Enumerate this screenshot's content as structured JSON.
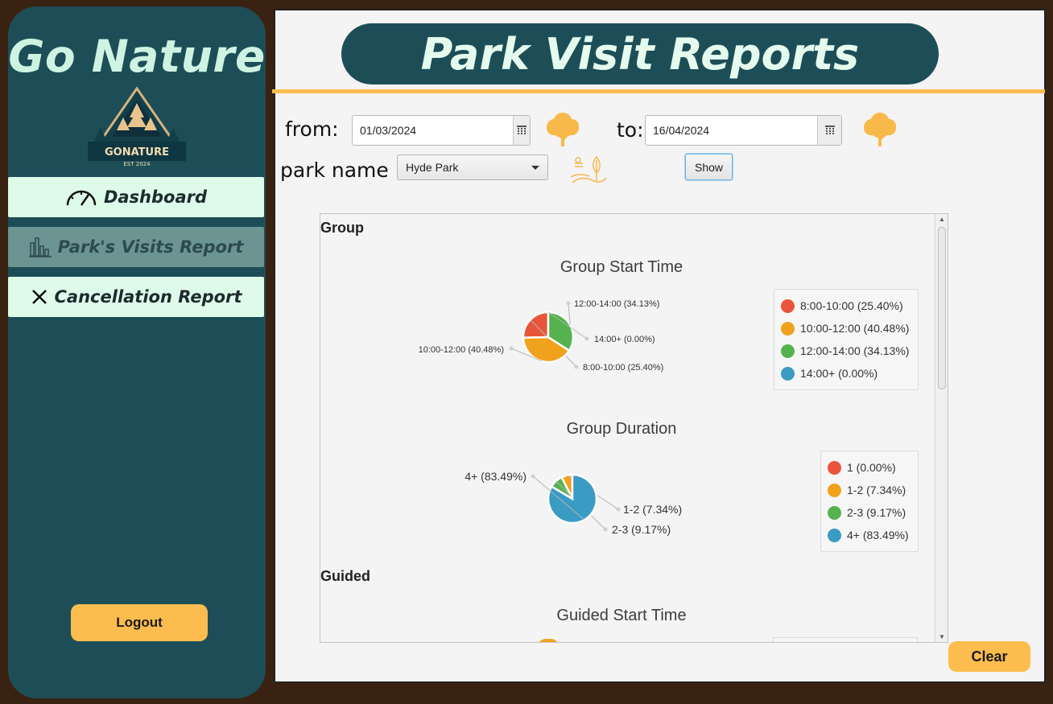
{
  "sidebar": {
    "brand": "Go Nature",
    "logo_text": "GONATURE",
    "logo_sub": "EST 2024",
    "items": [
      {
        "label": "Dashboard",
        "icon": "speedometer-icon"
      },
      {
        "label": "Park's Visits Report",
        "icon": "bar-chart-icon"
      },
      {
        "label": "Cancellation Report",
        "icon": "close-icon"
      }
    ],
    "logout_label": "Logout"
  },
  "header": {
    "title": "Park Visit Reports"
  },
  "filters": {
    "from_label": "from:",
    "from_value": "01/03/2024",
    "to_label": "to:",
    "to_value": "16/04/2024",
    "park_label": "park name :",
    "park_value": "Hyde Park",
    "show_label": "Show"
  },
  "report": {
    "sections": [
      {
        "title": "Group"
      },
      {
        "title": "Guided"
      }
    ]
  },
  "chart_data": [
    {
      "type": "pie",
      "title": "Group Start Time",
      "labels": [
        "8:00-10:00 (25.40%)",
        "10:00-12:00 (40.48%)",
        "12:00-14:00 (34.13%)",
        "14:00+ (0.00%)"
      ],
      "values": [
        25.4,
        40.48,
        34.13,
        0.0
      ],
      "colors": [
        "#e8553a",
        "#f0a21d",
        "#55b24f",
        "#3a9bc3"
      ]
    },
    {
      "type": "pie",
      "title": "Group Duration",
      "labels": [
        "1 (0.00%)",
        "1-2 (7.34%)",
        "2-3 (9.17%)",
        "4+ (83.49%)"
      ],
      "values": [
        0.0,
        7.34,
        9.17,
        83.49
      ],
      "colors": [
        "#e8553a",
        "#f0a21d",
        "#55b24f",
        "#3a9bc3"
      ]
    },
    {
      "type": "pie",
      "title": "Guided Start Time",
      "labels": [],
      "values": [],
      "colors": [
        "#e8553a",
        "#f0a21d",
        "#55b24f",
        "#3a9bc3"
      ]
    }
  ],
  "clear_label": "Clear"
}
